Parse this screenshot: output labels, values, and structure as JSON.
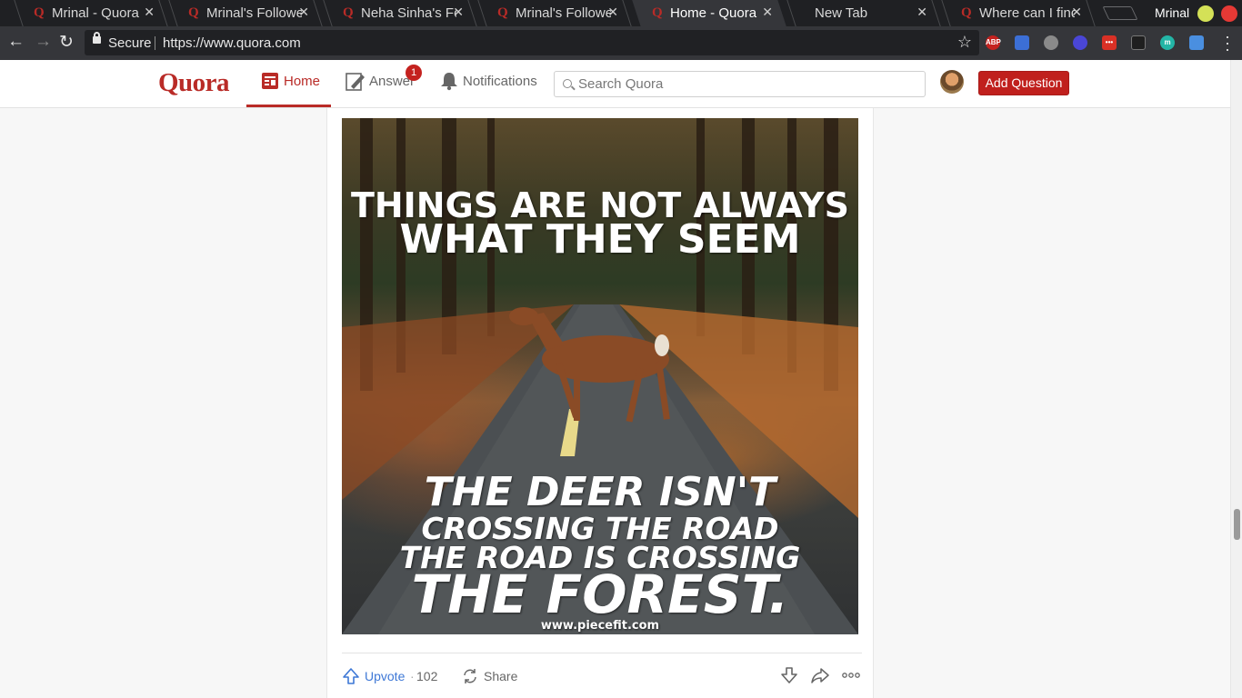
{
  "browser": {
    "tabs": [
      {
        "title": "Mrinal - Quora",
        "icon": "quora-icon",
        "active": false
      },
      {
        "title": "Mrinal's Followe",
        "icon": "quora-icon",
        "active": false
      },
      {
        "title": "Neha Sinha's Fol",
        "icon": "quora-icon",
        "active": false
      },
      {
        "title": "Mrinal's Followe",
        "icon": "quora-icon",
        "active": false
      },
      {
        "title": "Home - Quora",
        "icon": "quora-icon",
        "active": true
      },
      {
        "title": "New Tab",
        "icon": "",
        "active": false
      },
      {
        "title": "Where can I find",
        "icon": "quora-icon",
        "active": false
      }
    ],
    "tab_icon_glyph": "Q",
    "close_glyph": "✕",
    "profile_name": "Mrinal",
    "secure_label": "Secure",
    "url": "https://www.quora.com",
    "extensions": [
      {
        "name": "adblock-plus-icon",
        "label": "ABP",
        "color": "#c4221f"
      },
      {
        "name": "extension-blue-icon",
        "label": "",
        "color": "#3c6fd6"
      },
      {
        "name": "extension-cloud-icon",
        "label": "",
        "color": "#8a8a8a"
      },
      {
        "name": "extension-moon-icon",
        "label": "",
        "color": "#4a46d6"
      },
      {
        "name": "extension-dots-icon",
        "label": "•••",
        "color": "#d93025"
      },
      {
        "name": "extension-bird-icon",
        "label": "",
        "color": "#1f1f1f"
      },
      {
        "name": "extension-m-icon",
        "label": "m",
        "color": "#23b5a6"
      },
      {
        "name": "extension-plane-icon",
        "label": "",
        "color": "#4a8fe0"
      }
    ],
    "window_buttons": {
      "minimize_color": "#d4e157",
      "close_color": "#e53935"
    }
  },
  "header": {
    "logo": "Quora",
    "nav": {
      "home_label": "Home",
      "answer_label": "Answer",
      "answer_badge": "1",
      "notifications_label": "Notifications"
    },
    "search_placeholder": "Search Quora",
    "add_question_label": "Add Question"
  },
  "post": {
    "image_text": {
      "line1": "THINGS ARE NOT ALWAYS",
      "line2": "WHAT THEY SEEM",
      "line3": "THE DEER ISN'T",
      "line4": "CROSSING THE ROAD",
      "line5": "THE ROAD IS CROSSING",
      "line6": "THE FOREST.",
      "credit": "www.piecefit.com"
    },
    "actions": {
      "upvote_label": "Upvote",
      "upvote_count": "102",
      "share_label": "Share"
    }
  },
  "colors": {
    "brand": "#b92b27",
    "chrome_dark": "#1f2023",
    "chrome_toolbar": "#35363a"
  }
}
